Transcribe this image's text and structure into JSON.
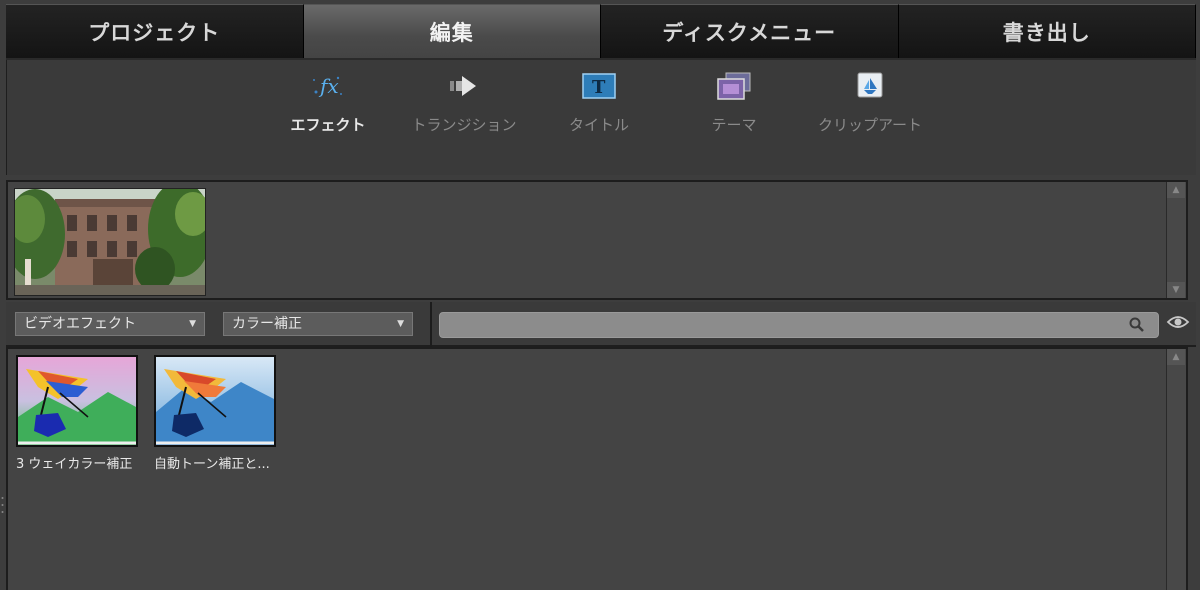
{
  "tabs": [
    {
      "label": "プロジェクト",
      "active": false
    },
    {
      "label": "編集",
      "active": true
    },
    {
      "label": "ディスクメニュー",
      "active": false
    },
    {
      "label": "書き出し",
      "active": false
    }
  ],
  "toolbar": {
    "items": [
      {
        "label": "エフェクト",
        "icon": "fx-icon",
        "active": true
      },
      {
        "label": "トランジション",
        "icon": "transition-arrow-icon",
        "active": false
      },
      {
        "label": "タイトル",
        "icon": "title-t-icon",
        "active": false
      },
      {
        "label": "テーマ",
        "icon": "theme-icon",
        "active": false
      },
      {
        "label": "クリップアート",
        "icon": "clipart-icon",
        "active": false
      }
    ]
  },
  "filters": {
    "category": "ビデオエフェクト",
    "subcategory": "カラー補正",
    "search_placeholder": ""
  },
  "effects": [
    {
      "label": "3 ウェイカラー補正",
      "tint": "green-pink"
    },
    {
      "label": "自動トーン補正と...",
      "tint": "blue"
    }
  ],
  "colors": {
    "tab_active": "#555555",
    "tab_inactive": "#1b1b1b",
    "panel": "#444444",
    "accent_fx": "#4fa3e0"
  }
}
